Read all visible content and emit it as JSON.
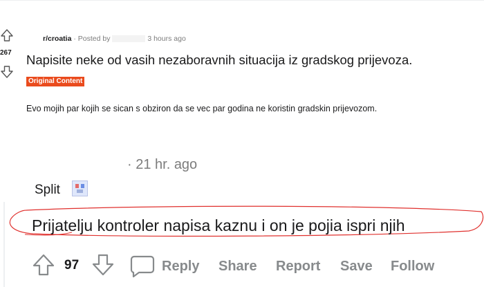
{
  "post": {
    "subreddit": "r/croatia",
    "posted_by": "· Posted by",
    "time": "3 hours ago",
    "vote_count": "267",
    "title": "Napisite neke od vasih nezaboravnih situacija iz gradskog prijevoza.",
    "flair": "Original Content",
    "body": "Evo mojih par kojih se sican s obziron da se vec par godina ne koristin gradskin prijevozom."
  },
  "comment": {
    "time": "· 21 hr. ago",
    "username": "Split",
    "text": "Prijatelju kontroler napisa kaznu i on je pojia ispri njih",
    "vote_count": "97",
    "actions": {
      "reply": "Reply",
      "share": "Share",
      "report": "Report",
      "save": "Save",
      "follow": "Follow"
    }
  },
  "colors": {
    "flair_bg": "#ea4b1d",
    "muted_text": "#878a8c",
    "annotation_stroke": "#e0302d"
  }
}
